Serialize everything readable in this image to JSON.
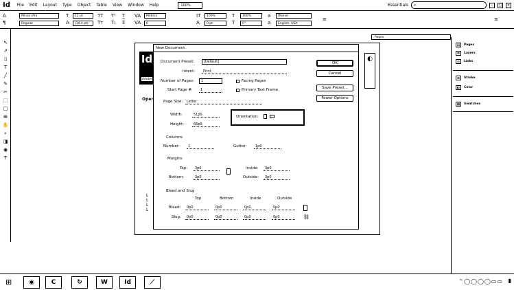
{
  "app": {
    "logo": "Id",
    "menus": [
      "File",
      "Edit",
      "Layout",
      "Type",
      "Object",
      "Table",
      "View",
      "Window",
      "Help"
    ],
    "zoom": "100%",
    "workspace": "Essentials",
    "minimize": "–",
    "maximize": "□",
    "close": "×"
  },
  "control_panel": {
    "font_family": "Minion Pro",
    "font_style": "Regular",
    "font_size": "12 pt",
    "leading": "(14.4 pt)",
    "kerning": "Metrics",
    "tracking": "0",
    "vscale": "100%",
    "hscale": "100%",
    "baseline": "0 pt",
    "skew": "0°",
    "char_style": "[None]",
    "language": "English: USA"
  },
  "tools": [
    "↖",
    "↗",
    "▯",
    "T",
    "╱",
    "✎",
    "✂",
    "⬚",
    "□",
    "⊞",
    "✋",
    "⌕",
    "◨",
    "◉",
    "T"
  ],
  "right_panels": {
    "tab": "Pages",
    "items": [
      "Pages",
      "Layers",
      "Links",
      "Stroke",
      "Color",
      "Swatches"
    ],
    "icons": [
      "▤",
      "≋",
      "∞",
      "≡",
      "◐",
      "▦"
    ]
  },
  "welcome": {
    "logo": "Id",
    "ribbon": "Adobe",
    "open_label": "Open",
    "recent_marks": "L\nL\nL\nL",
    "promo": "◐"
  },
  "dialog": {
    "title": "New Document",
    "document_preset_label": "Document Preset:",
    "document_preset": "[Default]",
    "intent_label": "Intent:",
    "intent": "Print",
    "num_pages_label": "Number of Pages:",
    "num_pages": "1",
    "facing_pages": "Facing Pages",
    "start_page_label": "Start Page #:",
    "start_page": "1",
    "primary_text_frame": "Primary Text Frame",
    "page_size_label": "Page Size:",
    "page_size": "Letter",
    "width_label": "Width:",
    "width": "51p0",
    "height_label": "Height:",
    "height": "66p0",
    "orientation_label": "Orientation:",
    "columns_label": "Columns",
    "number_label": "Number:",
    "number": "1",
    "gutter_label": "Gutter:",
    "gutter": "1p0",
    "margins_label": "Margins",
    "top_label": "Top:",
    "top": "3p0",
    "bottom_label": "Bottom:",
    "bottom": "3p0",
    "inside_label": "Inside:",
    "inside": "3p0",
    "outside_label": "Outside:",
    "outside": "3p0",
    "bleed_slug_label": "Bleed and Slug",
    "col_top": "Top",
    "col_bottom": "Bottom",
    "col_inside": "Inside",
    "col_outside": "Outside",
    "bleed_label": "Bleed:",
    "bleed_values": [
      "0p0",
      "0p0",
      "0p0",
      "0p0"
    ],
    "slug_label": "Slug:",
    "slug_values": [
      "0p0",
      "0p0",
      "0p0",
      "0p0"
    ],
    "ok": "OK",
    "cancel": "Cancel",
    "save_preset": "Save Preset...",
    "fewer_options": "Fewer Options"
  },
  "taskbar": {
    "start": "⊞",
    "apps": [
      "◉",
      "C",
      "↻",
      "W",
      "Id",
      "⟋"
    ],
    "tray": "⌃◯◯◯◯▭▭",
    "show_desktop": "▮"
  }
}
